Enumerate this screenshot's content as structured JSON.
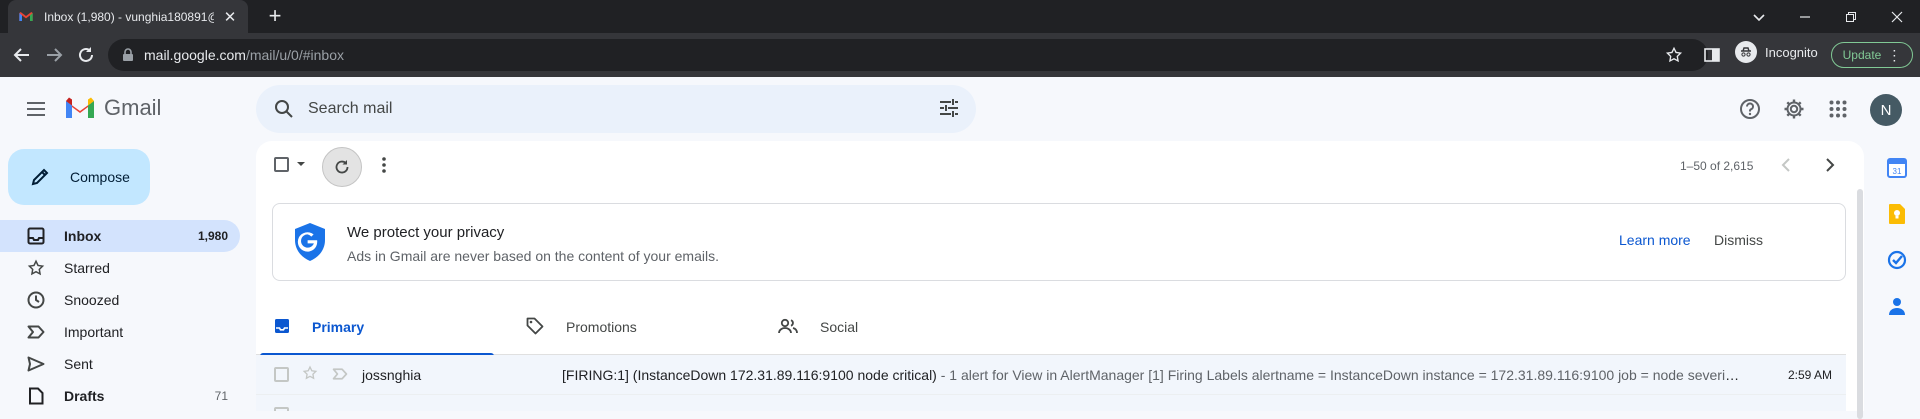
{
  "browser": {
    "tab_title": "Inbox (1,980) - vunghia180891@",
    "url_host": "mail.google.com",
    "url_path": "/mail/u/0/#inbox",
    "incognito_label": "Incognito",
    "update_label": "Update"
  },
  "header": {
    "app_name": "Gmail",
    "search_placeholder": "Search mail",
    "avatar_letter": "N"
  },
  "compose": {
    "label": "Compose"
  },
  "nav": [
    {
      "label": "Inbox",
      "count": "1,980",
      "icon": "inbox-icon",
      "active": true
    },
    {
      "label": "Starred",
      "count": "",
      "icon": "star-icon"
    },
    {
      "label": "Snoozed",
      "count": "",
      "icon": "clock-icon"
    },
    {
      "label": "Important",
      "count": "",
      "icon": "important-icon"
    },
    {
      "label": "Sent",
      "count": "",
      "icon": "send-icon"
    },
    {
      "label": "Drafts",
      "count": "71",
      "icon": "draft-icon"
    }
  ],
  "mail_toolbar": {
    "pagination": "1–50 of 2,615"
  },
  "privacy_banner": {
    "title": "We protect your privacy",
    "text": "Ads in Gmail are never based on the content of your emails.",
    "learn_more": "Learn more",
    "dismiss": "Dismiss"
  },
  "tabs": [
    {
      "label": "Primary",
      "icon": "inbox-tab-icon",
      "active": true
    },
    {
      "label": "Promotions",
      "icon": "tag-icon"
    },
    {
      "label": "Social",
      "icon": "people-icon"
    }
  ],
  "emails": [
    {
      "sender": "jossnghia",
      "subject": "[FIRING:1] (InstanceDown 172.31.89.116:9100 node critical)",
      "snippet": " - 1 alert for View in AlertManager [1] Firing Labels alertname = InstanceDown instance = 172.31.89.116:9100 job = node severity ...",
      "time": "2:59 AM"
    }
  ],
  "colors": {
    "accent": "#0b57d0",
    "compose_bg": "#c2e7ff",
    "active_nav_bg": "#d3e3fd",
    "page_bg": "#f6f8fc"
  }
}
